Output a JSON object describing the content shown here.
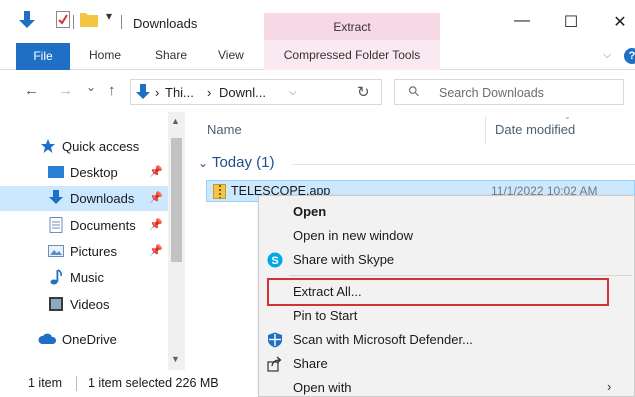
{
  "window": {
    "title": "Downloads",
    "context_tab_header": "Extract",
    "controls": {
      "minimize": "—",
      "maximize": "☐",
      "close": "✕"
    }
  },
  "ribbon": {
    "tabs": [
      "File",
      "Home",
      "Share",
      "View"
    ],
    "context_tab": "Compressed Folder Tools",
    "chevron": "⌵",
    "help": "?"
  },
  "navigation": {
    "back": "←",
    "forward": "→",
    "recent": "⌄",
    "up": "↑",
    "breadcrumb": [
      "Thi...",
      "Downl..."
    ],
    "breadcrumb_sep": "›",
    "refresh": "↻",
    "search_placeholder": "Search Downloads"
  },
  "nav_pane": {
    "items": [
      {
        "label": "Quick access",
        "icon": "star-icon",
        "pinned": false,
        "selected": false
      },
      {
        "label": "Desktop",
        "icon": "desktop-folder-icon",
        "pinned": true,
        "selected": false
      },
      {
        "label": "Downloads",
        "icon": "downloads-icon",
        "pinned": true,
        "selected": true
      },
      {
        "label": "Documents",
        "icon": "documents-icon",
        "pinned": true,
        "selected": false
      },
      {
        "label": "Pictures",
        "icon": "pictures-icon",
        "pinned": true,
        "selected": false
      },
      {
        "label": "Music",
        "icon": "music-icon",
        "pinned": false,
        "selected": false
      },
      {
        "label": "Videos",
        "icon": "videos-icon",
        "pinned": false,
        "selected": false
      },
      {
        "label": "OneDrive",
        "icon": "onedrive-icon",
        "pinned": false,
        "selected": false
      }
    ]
  },
  "content": {
    "columns": {
      "name": "Name",
      "date_modified": "Date modified"
    },
    "group_header": "Today (1)",
    "files": [
      {
        "name": "TELESCOPE.app",
        "date": "11/1/2022 10:02 AM",
        "icon": "zip-folder-icon"
      }
    ]
  },
  "status": {
    "item_count": "1 item",
    "selection": "1 item selected 226 MB"
  },
  "context_menu": {
    "items": [
      {
        "label": "Open",
        "bold": true,
        "icon": ""
      },
      {
        "label": "Open in new window",
        "bold": false,
        "icon": ""
      },
      {
        "label": "Share with Skype",
        "bold": false,
        "icon": "skype-icon"
      },
      {
        "label": "Extract All...",
        "bold": false,
        "icon": "",
        "highlighted": true
      },
      {
        "label": "Pin to Start",
        "bold": false,
        "icon": ""
      },
      {
        "label": "Scan with Microsoft Defender...",
        "bold": false,
        "icon": "defender-icon"
      },
      {
        "label": "Share",
        "bold": false,
        "icon": "share-icon"
      },
      {
        "label": "Open with",
        "bold": false,
        "icon": "",
        "submenu": true
      }
    ],
    "submenu_arrow": "›"
  },
  "colors": {
    "accent": "#1f6fc5",
    "selection": "#cce8ff",
    "context_tab": "#f7d9e6",
    "highlight_border": "#d13438",
    "group_text": "#1e4e8c"
  }
}
